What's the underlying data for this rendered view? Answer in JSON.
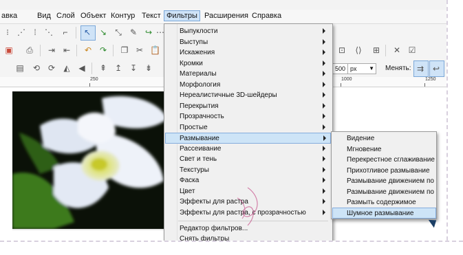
{
  "menubar": {
    "items": [
      "авка",
      "Вид",
      "Слой",
      "Объект",
      "Контур",
      "Текст",
      "Фильтры",
      "Расширения",
      "Справка"
    ],
    "active": "Фильтры"
  },
  "toolbar": {
    "unit_value": "500",
    "unit": "px",
    "change_label": "Менять:"
  },
  "ruler": {
    "labels": [
      "250",
      "1000",
      "1250"
    ]
  },
  "filters_menu": {
    "items": [
      {
        "label": "Выпуклости",
        "submenu": true
      },
      {
        "label": "Выступы",
        "submenu": true
      },
      {
        "label": "Искажения",
        "submenu": true
      },
      {
        "label": "Кромки",
        "submenu": true
      },
      {
        "label": "Материалы",
        "submenu": true
      },
      {
        "label": "Морфология",
        "submenu": true
      },
      {
        "label": "Нереалистичные 3D-шейдеры",
        "submenu": true
      },
      {
        "label": "Перекрытия",
        "submenu": true
      },
      {
        "label": "Прозрачность",
        "submenu": true
      },
      {
        "label": "Простые",
        "submenu": true
      },
      {
        "label": "Размывание",
        "submenu": true,
        "highlighted": true
      },
      {
        "label": "Рассеивание",
        "submenu": true
      },
      {
        "label": "Свет и тень",
        "submenu": true
      },
      {
        "label": "Текстуры",
        "submenu": true
      },
      {
        "label": "Фаска",
        "submenu": true
      },
      {
        "label": "Цвет",
        "submenu": true
      },
      {
        "label": "Эффекты для растра",
        "submenu": true
      },
      {
        "label": "Эффекты для растра, с прозрачностью",
        "submenu": true
      }
    ],
    "footer_items": [
      "Редактор фильтров...",
      "Снять фильтры"
    ]
  },
  "blur_submenu": {
    "items": [
      {
        "label": "Видение"
      },
      {
        "label": "Мгновение"
      },
      {
        "label": "Перекрестное сглаживание"
      },
      {
        "label": "Прихотливое размывание"
      },
      {
        "label": "Размывание движением по верти"
      },
      {
        "label": "Размывание движением по гориз"
      },
      {
        "label": "Размыть содержимое"
      },
      {
        "label": "Шумное размывание",
        "highlighted": true
      }
    ]
  },
  "colors": {
    "highlight_bg": "#cde4f7",
    "highlight_border": "#84acdd",
    "menu_bg": "#f0f0f0",
    "watermark": "#c0387a"
  }
}
